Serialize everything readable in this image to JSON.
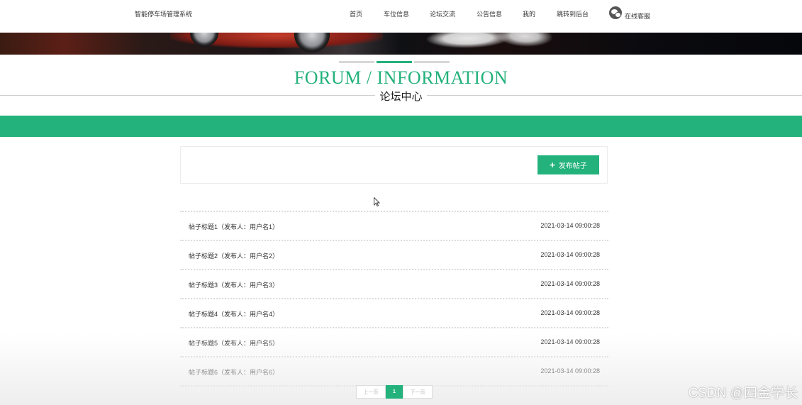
{
  "header": {
    "brand": "智能停车场管理系统",
    "nav": [
      {
        "id": "home",
        "label": "首页"
      },
      {
        "id": "parking",
        "label": "车位信息"
      },
      {
        "id": "forum",
        "label": "论坛交流"
      },
      {
        "id": "notice",
        "label": "公告信息"
      },
      {
        "id": "mine",
        "label": "我的"
      },
      {
        "id": "admin",
        "label": "跳转到后台"
      }
    ],
    "service_label": "在线客服"
  },
  "section": {
    "title_en": "FORUM / INFORMATION",
    "title_cn": "论坛中心"
  },
  "toolbar": {
    "publish_label": "发布帖子"
  },
  "posts": [
    {
      "title": "帖子标题1（发布人：用户名1）",
      "date": "2021-03-14 09:00:28"
    },
    {
      "title": "帖子标题2（发布人：用户名2）",
      "date": "2021-03-14 09:00:28"
    },
    {
      "title": "帖子标题3（发布人：用户名3）",
      "date": "2021-03-14 09:00:28"
    },
    {
      "title": "帖子标题4（发布人：用户名4）",
      "date": "2021-03-14 09:00:28"
    },
    {
      "title": "帖子标题5（发布人：用户名5）",
      "date": "2021-03-14 09:00:28"
    },
    {
      "title": "帖子标题6（发布人：用户名6）",
      "date": "2021-03-14 09:00:28"
    }
  ],
  "pagination": {
    "prev": "上一页",
    "current": "1",
    "next": "下一页"
  },
  "watermark": "CSDN @四金学长",
  "colors": {
    "accent": "#23b27c",
    "text": "#333333"
  }
}
